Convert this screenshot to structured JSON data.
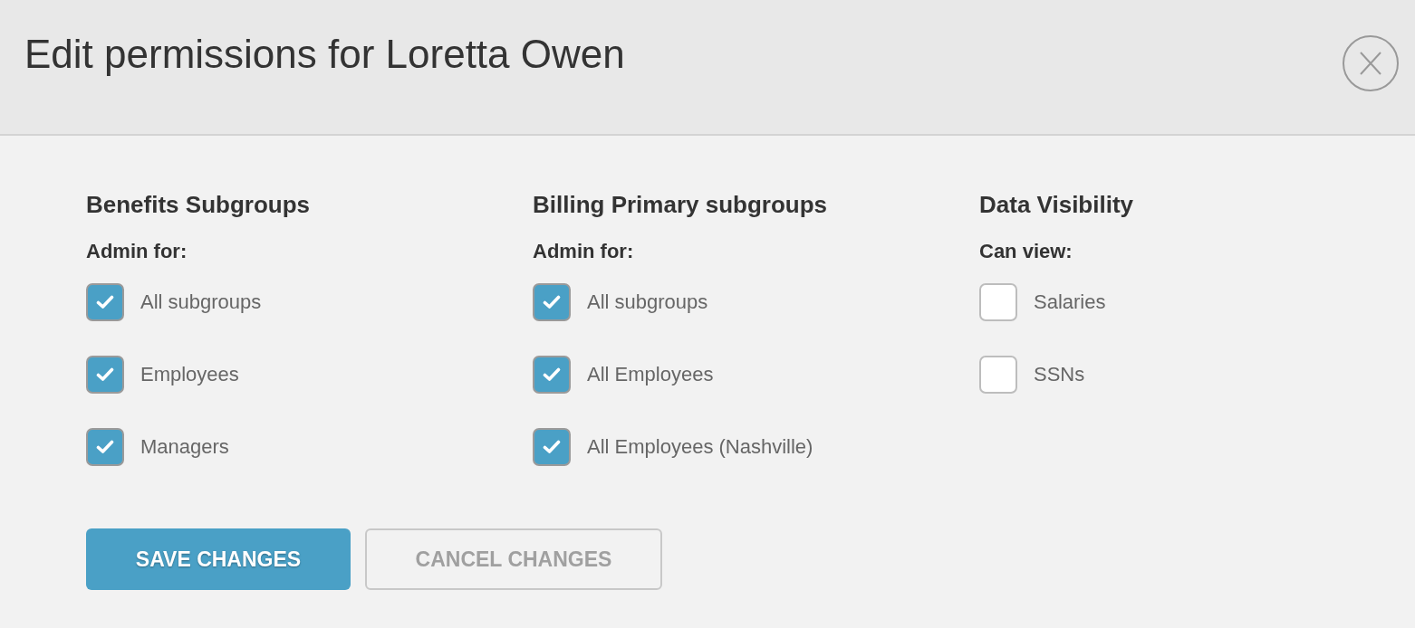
{
  "dialog": {
    "title": "Edit permissions for Loretta Owen"
  },
  "sections": [
    {
      "heading": "Benefits Subgroups",
      "subheading": "Admin for:",
      "options": [
        {
          "label": "All subgroups",
          "checked": true
        },
        {
          "label": "Employees",
          "checked": true
        },
        {
          "label": "Managers",
          "checked": true
        }
      ]
    },
    {
      "heading": "Billing Primary subgroups",
      "subheading": "Admin for:",
      "options": [
        {
          "label": "All subgroups",
          "checked": true
        },
        {
          "label": "All Employees",
          "checked": true
        },
        {
          "label": "All Employees (Nashville)",
          "checked": true
        }
      ]
    },
    {
      "heading": "Data Visibility",
      "subheading": "Can view:",
      "options": [
        {
          "label": "Salaries",
          "checked": false
        },
        {
          "label": "SSNs",
          "checked": false
        }
      ]
    }
  ],
  "buttons": [
    {
      "label": "SAVE CHANGES",
      "kind": "primary"
    },
    {
      "label": "CANCEL CHANGES",
      "kind": "secondary"
    }
  ]
}
